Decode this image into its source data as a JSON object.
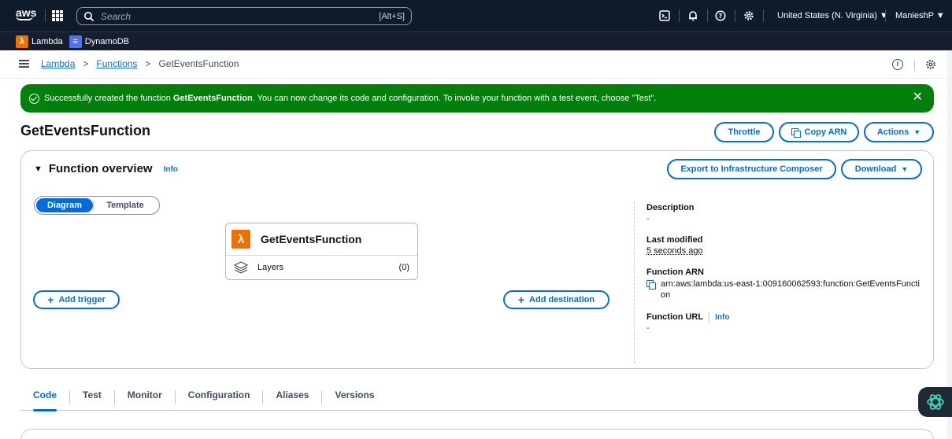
{
  "topnav": {
    "logo": "aws",
    "search_placeholder": "Search",
    "search_shortcut": "[Alt+S]",
    "region": "United States (N. Virginia) ▼",
    "user": "ManieshP ▼"
  },
  "favorites": [
    {
      "label": "Lambda",
      "color": "#ed7100",
      "icon": "lambda-icon"
    },
    {
      "label": "DynamoDB",
      "color": "#4d72f3",
      "icon": "dynamodb-icon"
    }
  ],
  "breadcrumb": {
    "items": [
      "Lambda",
      "Functions"
    ],
    "current": "GetEventsFunction",
    "separator": ">"
  },
  "flash": {
    "prefix": "Successfully created the function ",
    "function_name": "GetEventsFunction",
    "suffix": ". You can now change its code and configuration. To invoke your function with a test event, choose \"Test\".",
    "close": "✕",
    "color": "#037f0c"
  },
  "page": {
    "title": "GetEventsFunction",
    "buttons": {
      "throttle": "Throttle",
      "copy_arn": "Copy ARN",
      "actions": "Actions"
    }
  },
  "overview": {
    "title": "Function overview",
    "info": "Info",
    "export_button": "Export to Infrastructure Composer",
    "download_button": "Download",
    "segments": {
      "diagram": "Diagram",
      "template": "Template"
    },
    "function_card": {
      "name": "GetEventsFunction",
      "layers_label": "Layers",
      "layers_count": "(0)"
    },
    "add_trigger": "Add trigger",
    "add_destination": "Add destination",
    "details": {
      "description_label": "Description",
      "description_value": "-",
      "last_modified_label": "Last modified",
      "last_modified_value": "5 seconds ago",
      "arn_label": "Function ARN",
      "arn_value": "arn:aws:lambda:us-east-1:009160062593:function:GetEventsFunction",
      "url_label": "Function URL",
      "url_info": "Info",
      "url_value": "-"
    }
  },
  "tabs": [
    "Code",
    "Test",
    "Monitor",
    "Configuration",
    "Aliases",
    "Versions"
  ],
  "active_tab": "Code",
  "colors": {
    "accent": "#006ce0",
    "nav": "#0f1b2a",
    "success": "#037f0c"
  }
}
